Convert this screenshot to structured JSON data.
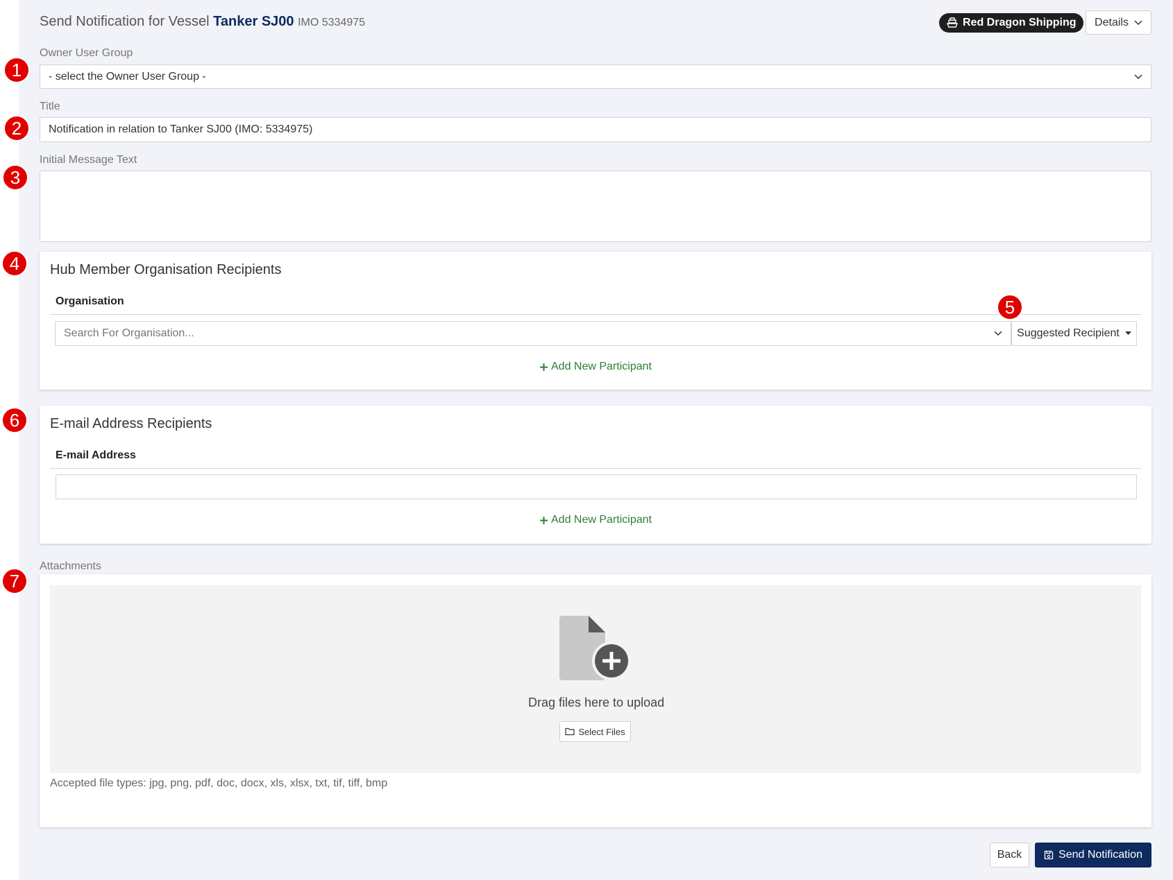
{
  "header": {
    "prefix": "Send Notification for Vessel",
    "vessel_name": "Tanker SJ00",
    "imo": "IMO 5334975",
    "company": "Red Dragon Shipping",
    "details_label": "Details"
  },
  "markers": [
    "1",
    "2",
    "3",
    "4",
    "5",
    "6",
    "7"
  ],
  "owner_group": {
    "label": "Owner User Group",
    "value": "- select the Owner User Group -"
  },
  "title_field": {
    "label": "Title",
    "value": "Notification in relation to Tanker SJ00 (IMO: 5334975)"
  },
  "message": {
    "label": "Initial Message Text",
    "value": ""
  },
  "hub_recipients": {
    "title": "Hub Member Organisation Recipients",
    "column": "Organisation",
    "search_placeholder": "Search For Organisation...",
    "suggested_label": "Suggested Recipient",
    "add_label": "Add New Participant"
  },
  "email_recipients": {
    "title": "E-mail Address Recipients",
    "column": "E-mail Address",
    "value": "",
    "add_label": "Add New Participant"
  },
  "attachments": {
    "label": "Attachments",
    "drop_text": "Drag files here to upload",
    "select_label": "Select Files",
    "accepted": "Accepted file types: jpg, png, pdf, doc, docx, xls, xlsx, txt, tif, tiff, bmp"
  },
  "footer": {
    "back_label": "Back",
    "send_label": "Send Notification"
  },
  "colors": {
    "accent": "#0d2b5e",
    "marker": "#e00000",
    "add_link": "#2f7d32"
  }
}
